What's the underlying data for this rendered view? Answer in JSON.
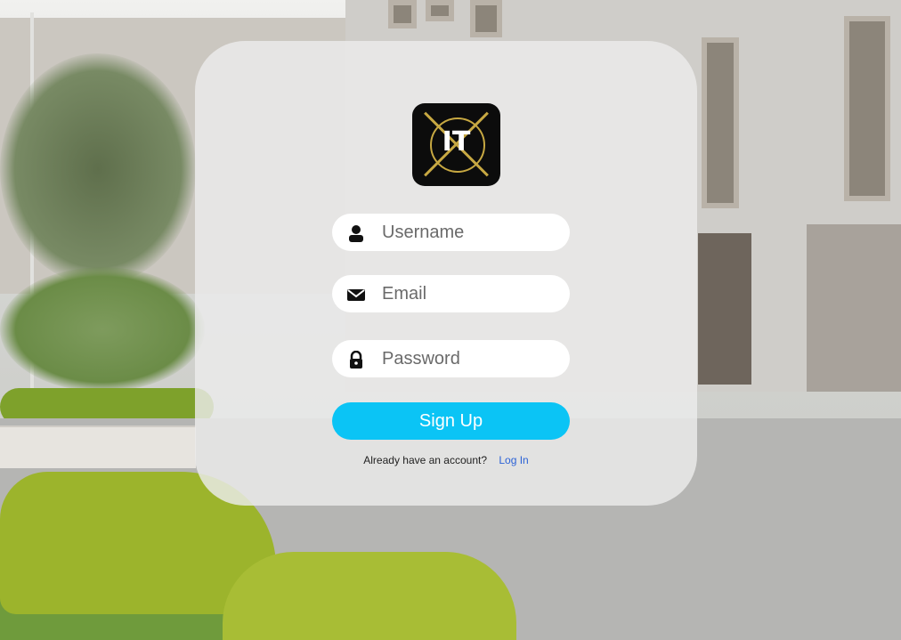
{
  "logo": {
    "text": "IT",
    "accent": "#c7a842"
  },
  "form": {
    "username": {
      "placeholder": "Username",
      "icon": "user-icon"
    },
    "email": {
      "placeholder": "Email",
      "icon": "envelope-icon"
    },
    "password": {
      "placeholder": "Password",
      "icon": "lock-icon"
    },
    "submit_label": "Sign Up",
    "footer_text": "Already have an account?",
    "login_link": "Log In"
  },
  "colors": {
    "button": "#0bc4f5",
    "link": "#2b62d6",
    "card": "#ebebec"
  }
}
